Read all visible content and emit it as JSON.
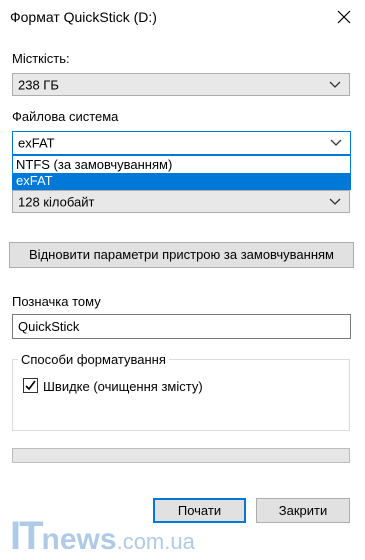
{
  "window": {
    "title": "Формат QuickStick (D:)"
  },
  "capacity": {
    "label": "Місткість:",
    "value": "238 ГБ"
  },
  "filesystem": {
    "label": "Файлова система",
    "value": "exFAT",
    "options": [
      "NTFS (за замовчуванням)",
      "exFAT"
    ],
    "selected_index": 1
  },
  "allocation": {
    "value": "128 кілобайт"
  },
  "restore_defaults_button": "Відновити параметри пристрою за замовчуванням",
  "volume_label": {
    "label": "Позначка тому",
    "value": "QuickStick"
  },
  "format_options": {
    "group_label": "Способи форматування",
    "quick_format_label": "Швидке (очищення змісту)",
    "quick_format_checked": true
  },
  "progress": {
    "value": 0
  },
  "buttons": {
    "start": "Почати",
    "close": "Закрити"
  },
  "watermark": {
    "prefix": "IT",
    "name": "news",
    "suffix": ".com.ua"
  },
  "colors": {
    "accent": "#0078d7",
    "watermark": "#1e6bb8"
  }
}
